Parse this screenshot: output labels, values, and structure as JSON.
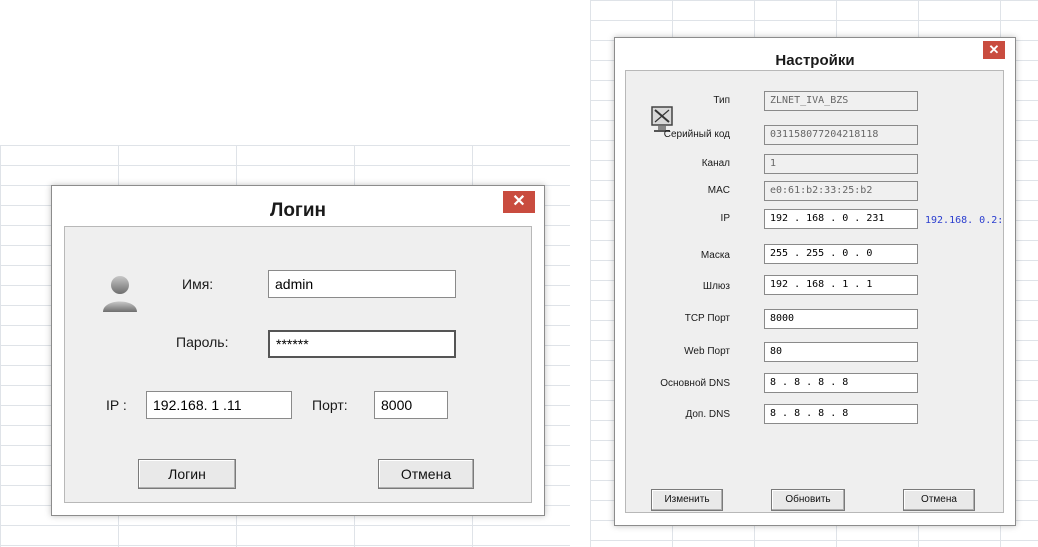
{
  "login": {
    "title": "Логин",
    "close": "✕",
    "name_label": "Имя:",
    "name_value": "admin",
    "password_label": "Пароль:",
    "password_value": "******",
    "ip_label": "IP :",
    "ip_value": "192.168. 1 .11",
    "port_label": "Порт:",
    "port_value": "8000",
    "login_button": "Логин",
    "cancel_button": "Отмена"
  },
  "settings": {
    "title": "Настройки",
    "close": "✕",
    "fields": [
      {
        "label": "Тип",
        "value": "ZLNET_IVA_BZS"
      },
      {
        "label": "Серийный код",
        "value": "031158077204218118"
      },
      {
        "label": "Канал",
        "value": "1"
      },
      {
        "label": "MAC",
        "value": "e0:61:b2:33:25:b2"
      },
      {
        "label": "IP",
        "value": "192 . 168 .  0  . 231"
      },
      {
        "label": "Маска",
        "value": "255 . 255 .  0  .  0"
      },
      {
        "label": "Шлюз",
        "value": "192 . 168 .  1  .  1"
      },
      {
        "label": "TCP Порт",
        "value": "8000"
      },
      {
        "label": "Web Порт",
        "value": "80"
      },
      {
        "label": "Основной DNS",
        "value": " 8  .  8  .  8  .  8"
      },
      {
        "label": "Доп. DNS",
        "value": " 8  .  8  .  8  .  8"
      }
    ],
    "ip_info": "192.168.  0.2:",
    "change_button": "Изменить",
    "refresh_button": "Обновить",
    "cancel_button": "Отмена"
  },
  "colors": {
    "close": "#c94c3f",
    "ip_info": "#2b3ecf"
  }
}
